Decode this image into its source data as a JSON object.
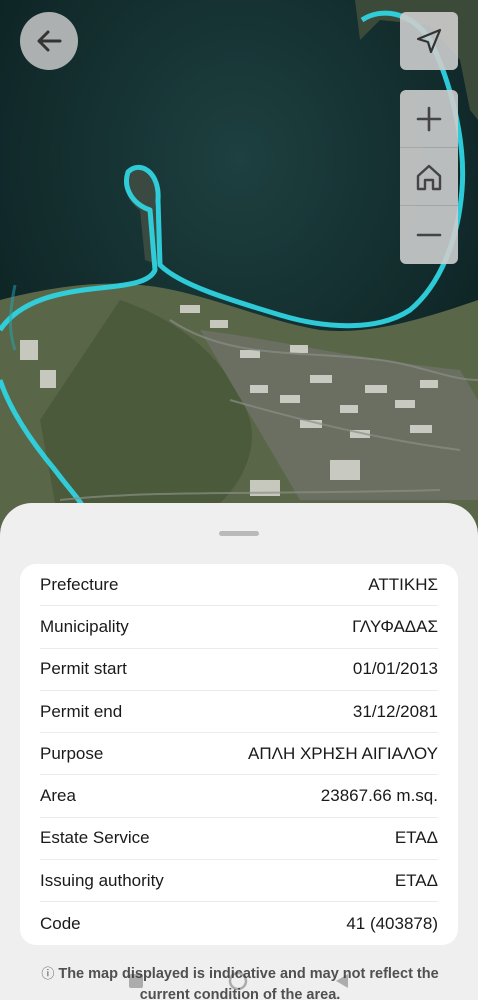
{
  "map": {
    "icons": {
      "back": "arrow-left-icon",
      "locate": "navigation-arrow-icon",
      "zoom_in": "plus-icon",
      "home": "home-icon",
      "zoom_out": "minus-icon"
    },
    "colors": {
      "shoreline_highlight": "#2fd3e0",
      "sea": "#0f2a2a",
      "land": "#5b6a4a"
    }
  },
  "details": {
    "rows": [
      {
        "label": "Prefecture",
        "value": "ΑΤΤΙΚΗΣ"
      },
      {
        "label": "Municipality",
        "value": "ΓΛΥΦΑΔΑΣ"
      },
      {
        "label": "Permit start",
        "value": "01/01/2013"
      },
      {
        "label": "Permit end",
        "value": "31/12/2081"
      },
      {
        "label": "Purpose",
        "value": "ΑΠΛΗ ΧΡΗΣΗ ΑΙΓΙΑΛΟΥ"
      },
      {
        "label": "Area",
        "value": "23867.66 m.sq."
      },
      {
        "label": "Estate Service",
        "value": "ΕΤΑΔ"
      },
      {
        "label": "Issuing authority",
        "value": "ΕΤΑΔ"
      },
      {
        "label": "Code",
        "value": "41 (403878)"
      }
    ]
  },
  "disclaimer": "The map displayed is indicative and may not reflect the current condition of the area.",
  "disclaimer_icon": "info-circle-icon"
}
